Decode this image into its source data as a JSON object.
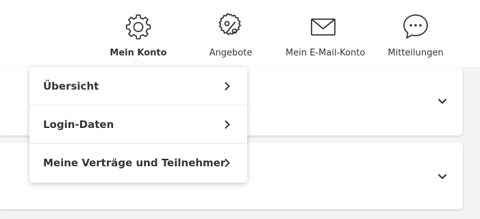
{
  "nav": {
    "items": [
      {
        "label": "Mein Konto",
        "icon": "gear-icon",
        "active": true
      },
      {
        "label": "Angebote",
        "icon": "percent-badge-icon",
        "active": false
      },
      {
        "label": "Mein E-Mail-Konto",
        "icon": "envelope-icon",
        "active": false
      },
      {
        "label": "Mitteilungen",
        "icon": "chat-bubble-icon",
        "active": false
      }
    ]
  },
  "dropdown": {
    "items": [
      {
        "label": "Übersicht"
      },
      {
        "label": "Login-Daten"
      },
      {
        "label": "Meine Verträge und Teilnehmer"
      }
    ]
  },
  "colors": {
    "text": "#333333",
    "background": "#f4f4f4",
    "surface": "#ffffff",
    "divider": "#e6e6e6"
  }
}
